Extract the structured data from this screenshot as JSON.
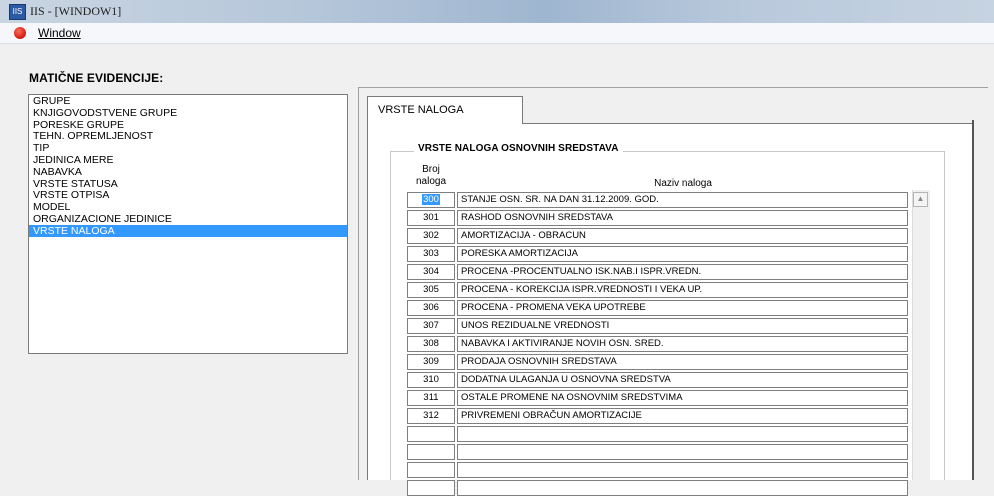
{
  "window": {
    "title": "IIS - [WINDOW1]"
  },
  "menu": {
    "window_label": "Window"
  },
  "evidence": {
    "heading": "MATIČNE EVIDENCIJE:",
    "items": [
      "GRUPE",
      "KNJIGOVODSTVENE GRUPE",
      "PORESKE GRUPE",
      "TEHN. OPREMLJENOST",
      "TIP",
      "JEDINICA MERE",
      "NABAVKA",
      "VRSTE STATUSA",
      "VRSTE OTPISA",
      "MODEL",
      "ORGANIZACIONE JEDINICE",
      "VRSTE NALOGA"
    ],
    "selected_index": 11
  },
  "tab": {
    "label": "VRSTE NALOGA"
  },
  "group": {
    "title": "VRSTE NALOGA OSNOVNIH SREDSTAVA",
    "col_broj_line1": "Broj",
    "col_broj_line2": "naloga",
    "col_naziv": "Naziv naloga"
  },
  "rows": [
    {
      "broj": "300",
      "naziv": "STANJE OSN. SR. NA DAN 31.12.2009. GOD."
    },
    {
      "broj": "301",
      "naziv": "RASHOD OSNOVNIH SREDSTAVA"
    },
    {
      "broj": "302",
      "naziv": "AMORTIZACIJA - OBRACUN"
    },
    {
      "broj": "303",
      "naziv": "PORESKA AMORTIZACIJA"
    },
    {
      "broj": "304",
      "naziv": "PROCENA -PROCENTUALNO ISK.NAB.I ISPR.VREDN."
    },
    {
      "broj": "305",
      "naziv": "PROCENA - KOREKCIJA ISPR.VREDNOSTI I VEKA UP."
    },
    {
      "broj": "306",
      "naziv": "PROCENA - PROMENA VEKA UPOTREBE"
    },
    {
      "broj": "307",
      "naziv": "UNOS REZIDUALNE VREDNOSTI"
    },
    {
      "broj": "308",
      "naziv": "NABAVKA I AKTIVIRANJE NOVIH OSN. SRED."
    },
    {
      "broj": "309",
      "naziv": "PRODAJA OSNOVNIH SREDSTAVA"
    },
    {
      "broj": "310",
      "naziv": "DODATNA ULAGANJA U OSNOVNA SREDSTVA"
    },
    {
      "broj": "311",
      "naziv": "OSTALE PROMENE NA OSNOVNIM SREDSTVIMA"
    },
    {
      "broj": "312",
      "naziv": "PRIVREMENI OBRAČUN AMORTIZACIJE"
    },
    {
      "broj": "",
      "naziv": ""
    },
    {
      "broj": "",
      "naziv": ""
    },
    {
      "broj": "",
      "naziv": ""
    },
    {
      "broj": "",
      "naziv": ""
    }
  ],
  "icons": {
    "app": "app-icon",
    "mdi": "red-circle-icon",
    "scroll_up": "scroll-up-arrow-icon"
  }
}
